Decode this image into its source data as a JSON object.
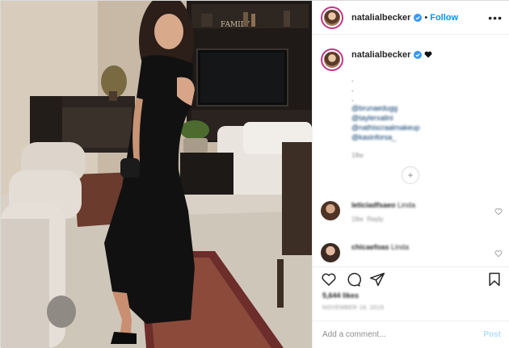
{
  "post": {
    "username": "natalialbecker",
    "follow_label": "Follow",
    "separator": "•",
    "more_label": "•••"
  },
  "caption": {
    "username": "natalialbecker",
    "dots": [
      ".",
      ".",
      "."
    ],
    "mentions": [
      "@brunaedugg",
      "@taylerxalini",
      "@nathiscraalmakeup",
      "@kasinforsa_"
    ],
    "time": "18w"
  },
  "load_more_symbol": "+",
  "comments": [
    {
      "username": "leticiadfsaeo",
      "text": "Linda",
      "time": "18w",
      "reply": "Reply"
    },
    {
      "username": "chicaefoas",
      "text": "Linda",
      "time": "",
      "reply": ""
    }
  ],
  "likes_text": "5,644 likes",
  "date_text": "NOVEMBER 18, 2019",
  "add_comment": {
    "placeholder": "Add a comment...",
    "post_label": "Post"
  },
  "photo": {
    "wall_sign": "FAMILY"
  },
  "colors": {
    "accent": "#0095f6",
    "post_disabled": "#b2dffc",
    "border": "#efefef",
    "verified": "#3897f0"
  },
  "icons": [
    "verified-badge-icon",
    "heart-icon",
    "comment-icon",
    "share-icon",
    "bookmark-icon",
    "plus-circle-icon"
  ]
}
